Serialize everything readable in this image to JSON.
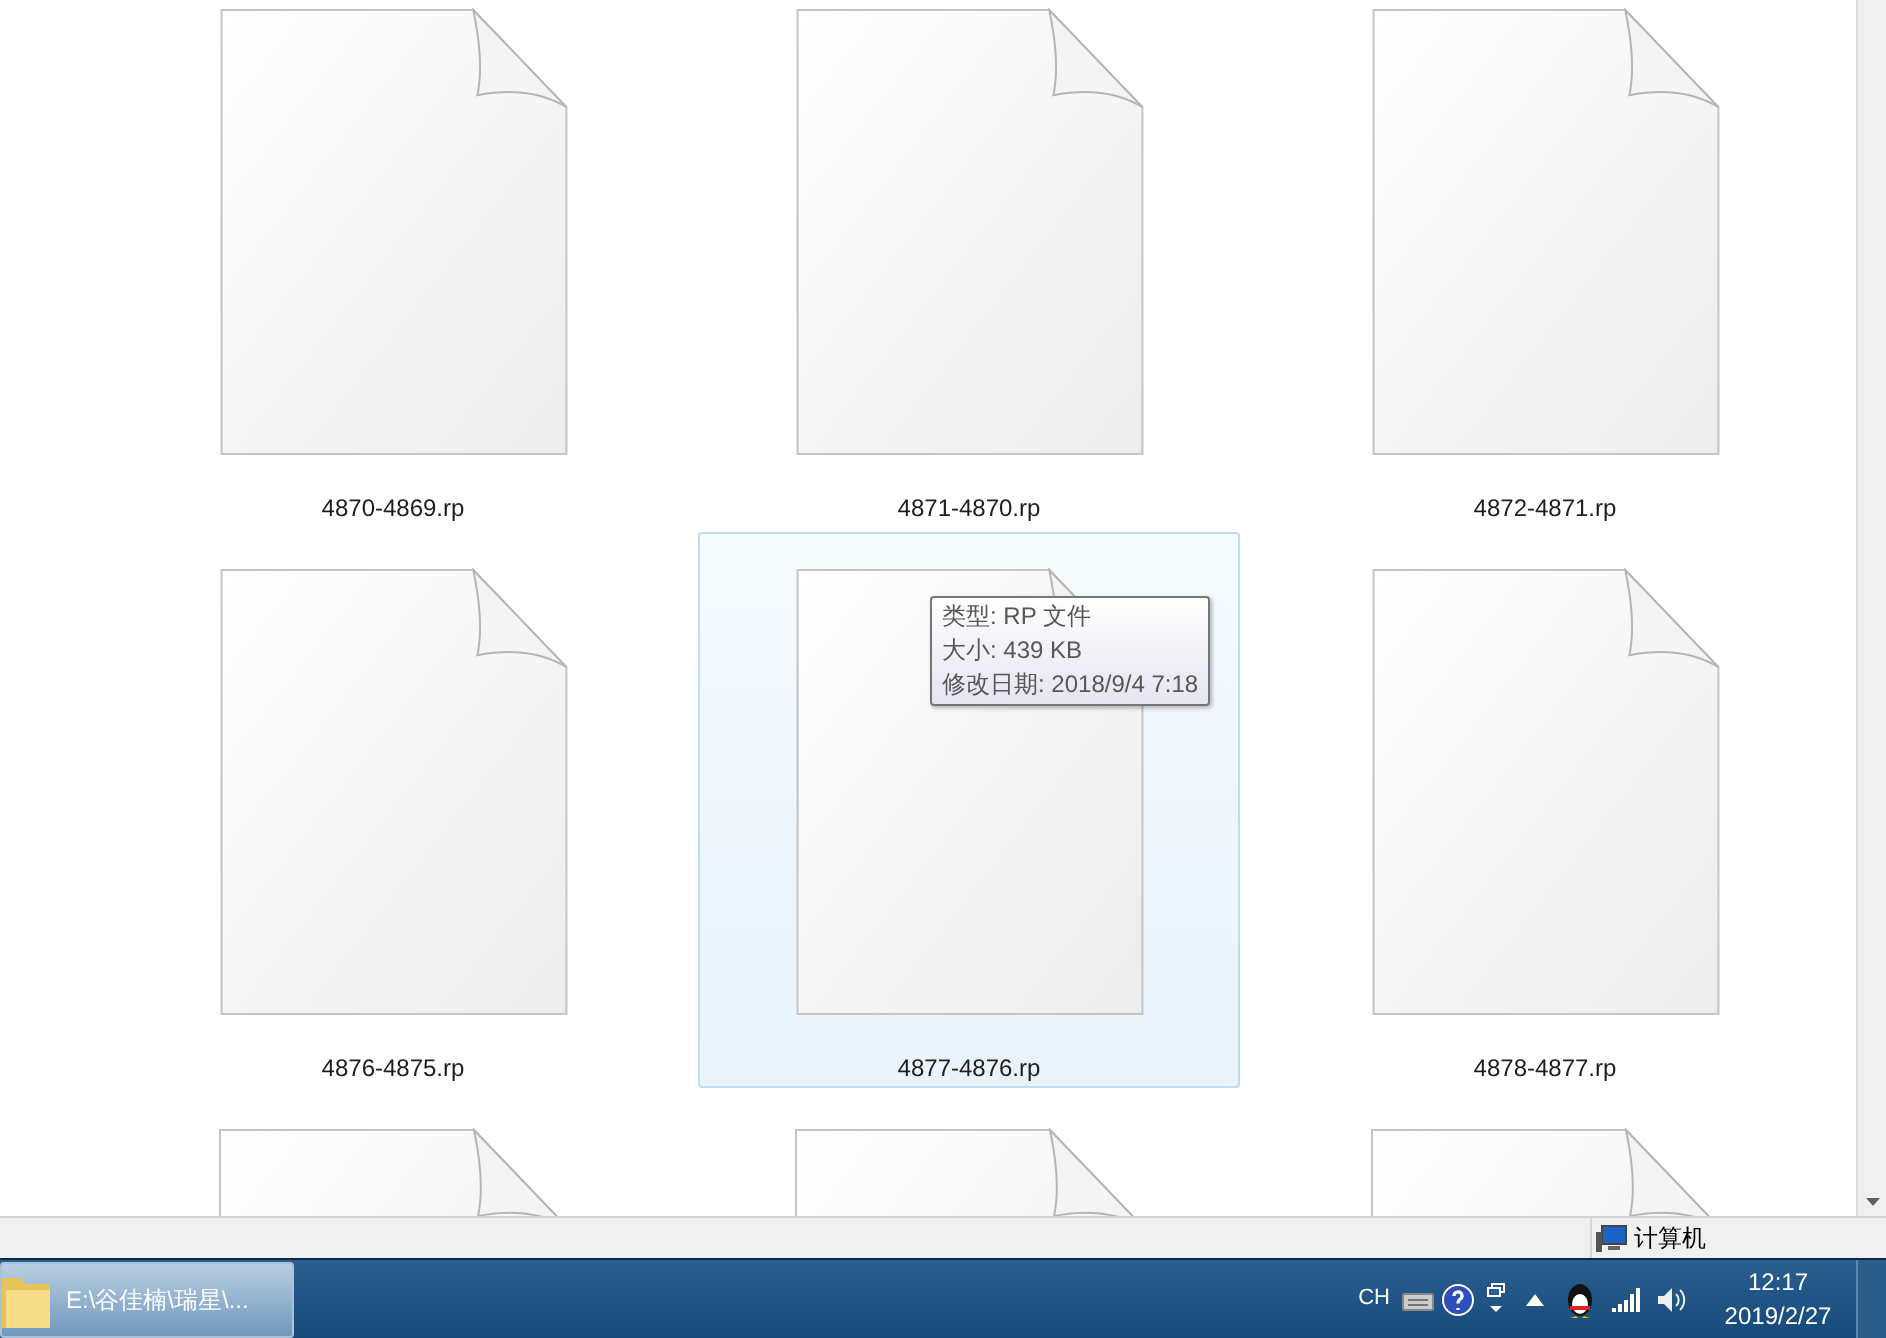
{
  "files": [
    {
      "name": "4870-4869.rp",
      "selected": false
    },
    {
      "name": "4871-4870.rp",
      "selected": false
    },
    {
      "name": "4872-4871.rp",
      "selected": false
    },
    {
      "name": "4876-4875.rp",
      "selected": false
    },
    {
      "name": "4877-4876.rp",
      "selected": true
    },
    {
      "name": "4878-4877.rp",
      "selected": false
    },
    {
      "selected": false
    },
    {
      "selected": false
    },
    {
      "selected": false
    }
  ],
  "tooltip": {
    "lines": [
      "类型: RP 文件",
      "大小: 439 KB",
      "修改日期: 2018/9/4 7:18"
    ]
  },
  "status_bar": {
    "location": "计算机"
  },
  "taskbar": {
    "window_button": "E:\\谷佳楠\\瑞星\\...",
    "language": "CH",
    "time": "12:17",
    "date": "2019/2/27"
  }
}
